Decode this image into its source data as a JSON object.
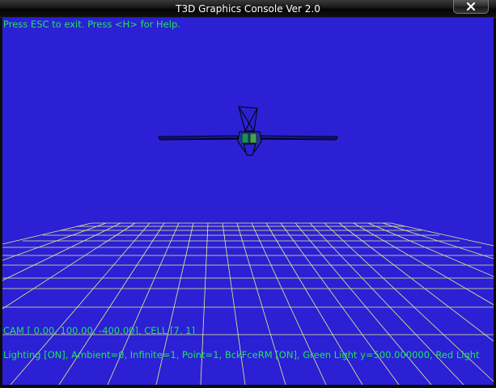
{
  "window": {
    "title": "T3D Graphics Console Ver 2.0",
    "close_icon": "close-icon"
  },
  "hud": {
    "help_text": "Press ESC to exit. Press <H> for Help.",
    "camera_text": "CAM [ 0.00, 100.00, -400.00], CELL [7, 1]",
    "lighting_text": "Lighting [ON], Ambient=0, Infinite=1, Point=1, BckFceRM [ON], Green Light y=500.000000, Red Light"
  },
  "colors": {
    "background": "#2b20d4",
    "hud_text": "#1ee65a",
    "grid": "#e8f08a",
    "model_outline": "#000000"
  }
}
